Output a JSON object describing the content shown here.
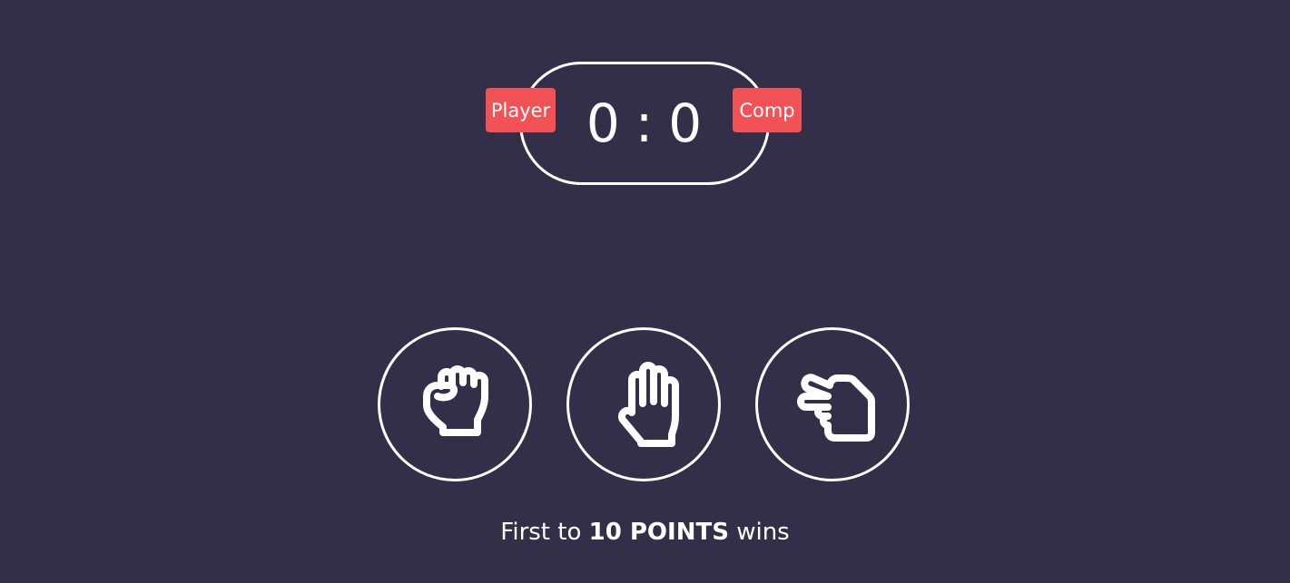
{
  "scoreboard": {
    "player_label": "Player",
    "comp_label": "Comp",
    "player_score": "0",
    "separator": ":",
    "comp_score": "0"
  },
  "choices": [
    {
      "name": "rock",
      "icon": "rock-hand-icon"
    },
    {
      "name": "paper",
      "icon": "paper-hand-icon"
    },
    {
      "name": "scissors",
      "icon": "scissors-hand-icon"
    }
  ],
  "footer": {
    "prefix": "First to",
    "points": "10 POINTS",
    "suffix": "wins"
  },
  "colors": {
    "background": "#342f48",
    "badge": "#f25155",
    "foreground": "#ffffff"
  }
}
